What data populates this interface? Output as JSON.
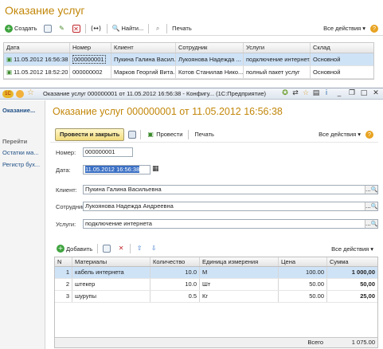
{
  "list_window": {
    "title": "Оказание услуг",
    "toolbar": {
      "create_label": "Создать",
      "find_label": "Найти...",
      "print_label": "Печать",
      "all_actions_label": "Все действия"
    },
    "columns": [
      "Дата",
      "Номер",
      "Клиент",
      "Сотрудник",
      "Услуги",
      "Склад"
    ],
    "rows": [
      {
        "date": "11.05.2012 16:56:38",
        "number": "000000001",
        "client": "Пукина Галина Васил...",
        "employee": "Лукоянова Надежда ...",
        "services": "подключение интернет...",
        "warehouse": "Основной"
      },
      {
        "date": "11.05.2012 18:52:20",
        "number": "000000002",
        "client": "Марков Георгий Вита...",
        "employee": "Котов Станилав Нико...",
        "services": "полный пакет услуг",
        "warehouse": "Основной"
      }
    ]
  },
  "doc_window": {
    "window_title": "Оказание услуг 000000001 от 11.05.2012 16:56:38 - Конфигу... (1С:Предприятие)",
    "sidebar": {
      "active": "Оказание...",
      "goto_label": "Перейти",
      "links": [
        "Остатки ма...",
        "Регистр бух..."
      ]
    },
    "title": "Оказание услуг 000000001 от 11.05.2012 16:56:38",
    "toolbar": {
      "post_close_label": "Провести и закрыть",
      "post_label": "Провести",
      "print_label": "Печать",
      "all_actions_label": "Все действия"
    },
    "fields": {
      "number_label": "Номер:",
      "number_value": "000000001",
      "date_label": "Дата:",
      "date_value": "11.05.2012 16:56:38",
      "client_label": "Клиент:",
      "client_value": "Пукина Галина Васильевна",
      "employee_label": "Сотрудник:",
      "employee_value": "Лукоянова Надежда Андреевна",
      "services_label": "Услуги:",
      "services_value": "подключение интернета"
    },
    "materials": {
      "add_label": "Добавить",
      "all_actions_label": "Все действия",
      "columns": [
        "N",
        "Материалы",
        "Количество",
        "Единица измерения",
        "Цена",
        "Сумма"
      ],
      "rows": [
        {
          "n": "1",
          "material": "кабель интернета",
          "qty": "10.0",
          "unit": "М",
          "price": "100.00",
          "sum": "1 000,00"
        },
        {
          "n": "2",
          "material": "штекер",
          "qty": "10.0",
          "unit": "Шт",
          "price": "50.00",
          "sum": "50,00"
        },
        {
          "n": "3",
          "material": "шурупы",
          "qty": "0.5",
          "unit": "Кг",
          "price": "50.00",
          "sum": "25,00"
        }
      ],
      "total_label": "Всего",
      "total_value": "1 075.00"
    }
  }
}
